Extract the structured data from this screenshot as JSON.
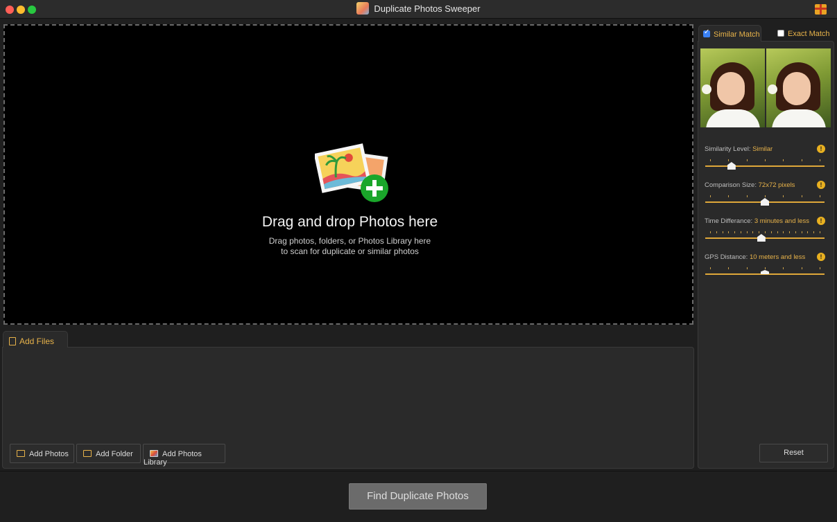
{
  "window": {
    "title": "Duplicate Photos Sweeper"
  },
  "dropzone": {
    "title": "Drag and drop Photos here",
    "subtitle_line1": "Drag photos, folders, or Photos Library here",
    "subtitle_line2": "to scan for duplicate or similar photos"
  },
  "files": {
    "tab_label": "Add Files",
    "buttons": {
      "add_photos": "Add Photos",
      "add_folder": "Add Folder",
      "add_library": "Add Photos Library"
    }
  },
  "match": {
    "similar_label": "Similar Match",
    "similar_checked": true,
    "exact_label": "Exact Match",
    "exact_checked": false
  },
  "settings": [
    {
      "label": "Similarity Level:",
      "value": "Similar",
      "ticks": 7,
      "position": 0.22
    },
    {
      "label": "Comparison Size:",
      "value": "72x72 pixels",
      "ticks": 7,
      "position": 0.5
    },
    {
      "label": "Time Differance:",
      "value": "3 minutes and less",
      "ticks": 19,
      "position": 0.47
    },
    {
      "label": "GPS Distance:",
      "value": "10 meters and less",
      "ticks": 7,
      "position": 0.5
    }
  ],
  "reset_label": "Reset",
  "find_label": "Find Duplicate Photos",
  "colors": {
    "accent": "#e8b34a",
    "warning": "#e8b020",
    "add_icon": "#1aa62a",
    "drop_bg": "#000000"
  }
}
